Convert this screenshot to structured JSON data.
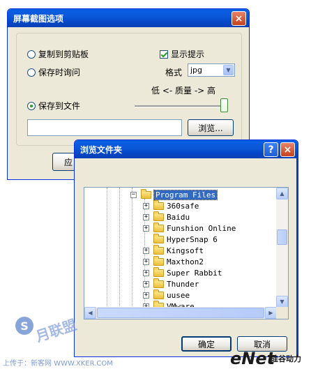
{
  "capture_dialog": {
    "title": "屏幕截图选项",
    "copy_to_clipboard": "复制到剪贴板",
    "save_time_query": "保存时询问",
    "save_to_file": "保存到文件",
    "show_hint": "显示提示",
    "format_label": "格式",
    "format_value": "jpg",
    "quality_label": "低 <- 质量 -> 高",
    "quality_level": 1.0,
    "file_path_value": "",
    "browse_button": "浏览...",
    "hidden_button_partial": "应"
  },
  "browse_dialog": {
    "title": "浏览文件夹",
    "help_glyph": "?",
    "close_glyph": "×",
    "tree": [
      {
        "label": "Program Files",
        "expander": "−",
        "selected": true
      },
      {
        "label": "360safe",
        "expander": "+"
      },
      {
        "label": "Baidu",
        "expander": "+"
      },
      {
        "label": "Funshion Online",
        "expander": "+"
      },
      {
        "label": "HyperSnap 6",
        "expander": ""
      },
      {
        "label": "Kingsoft",
        "expander": "+"
      },
      {
        "label": "Maxthon2",
        "expander": "+"
      },
      {
        "label": "Super Rabbit",
        "expander": "+"
      },
      {
        "label": "Thunder",
        "expander": "+"
      },
      {
        "label": "uusee",
        "expander": "+"
      },
      {
        "label": "VMware",
        "expander": "+"
      }
    ],
    "ok_button": "确定",
    "cancel_button": "取消"
  },
  "watermark": {
    "left_text": "上传于：新客网 WWW.XKER.COM",
    "left_logo": "S",
    "left_logo_text": "月联盟",
    "right_logo": "eNet",
    "right_logo_suffix": "硅谷动力"
  },
  "colors": {
    "titlebar": "#0a58d8",
    "selection": "#316ac5",
    "dialog_bg": "#ece9d8"
  }
}
